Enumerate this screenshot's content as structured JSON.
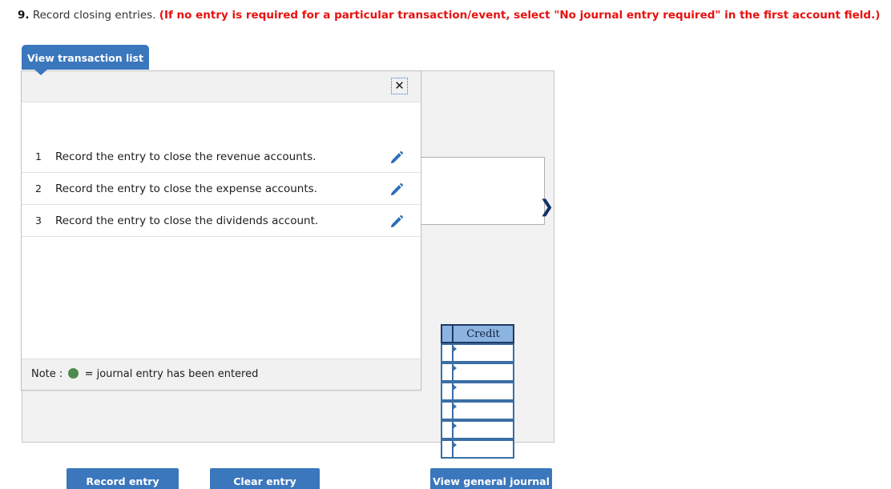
{
  "question": {
    "number": "9.",
    "text": "Record closing entries.",
    "hint": "(If no entry is required for a particular transaction/event, select \"No journal entry required\" in the first account field.)"
  },
  "tab": {
    "label": "View transaction list"
  },
  "popup": {
    "close_label": "✕",
    "transactions": [
      {
        "num": "1",
        "description": "Record the entry to close the revenue accounts."
      },
      {
        "num": "2",
        "description": "Record the entry to close the expense accounts."
      },
      {
        "num": "3",
        "description": "Record the entry to close the dividends account."
      }
    ],
    "note": {
      "prefix": "Note :",
      "suffix": "= journal entry has been entered"
    }
  },
  "journal": {
    "credit_header": "Credit",
    "row_count": 6,
    "rows": [
      "",
      "",
      "",
      "",
      "",
      ""
    ]
  },
  "actions": {
    "record_entry": "Record entry",
    "clear_entry": "Clear entry",
    "view_general_journal": "View general journal"
  },
  "colors": {
    "accent_blue": "#3a77bd",
    "hint_red": "#e8110f",
    "grid_header_blue": "#8cb4e0",
    "grid_border_blue": "#3a6ea5",
    "note_green": "#4e8a4e",
    "panel_gray": "#f2f2f2"
  },
  "icons": {
    "chevron_right": "❯",
    "pencil": "pencil-icon"
  }
}
